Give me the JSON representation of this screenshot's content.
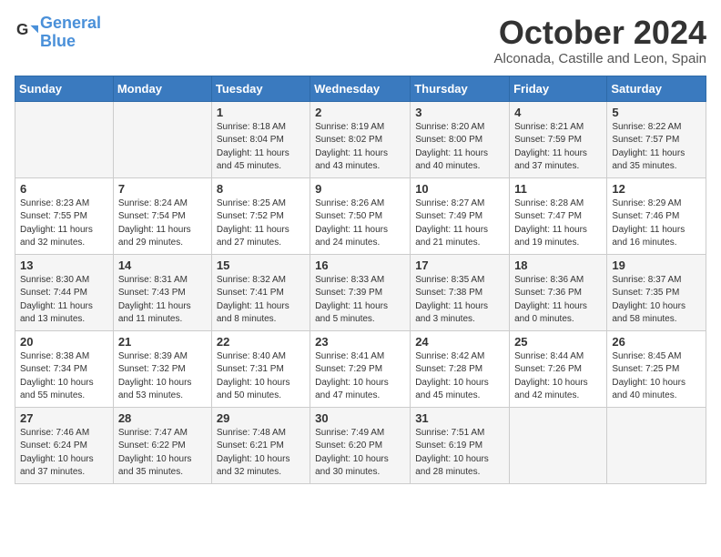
{
  "logo": {
    "line1": "General",
    "line2": "Blue"
  },
  "title": "October 2024",
  "location": "Alconada, Castille and Leon, Spain",
  "days_of_week": [
    "Sunday",
    "Monday",
    "Tuesday",
    "Wednesday",
    "Thursday",
    "Friday",
    "Saturday"
  ],
  "weeks": [
    [
      {
        "day": "",
        "info": ""
      },
      {
        "day": "",
        "info": ""
      },
      {
        "day": "1",
        "info": "Sunrise: 8:18 AM\nSunset: 8:04 PM\nDaylight: 11 hours and 45 minutes."
      },
      {
        "day": "2",
        "info": "Sunrise: 8:19 AM\nSunset: 8:02 PM\nDaylight: 11 hours and 43 minutes."
      },
      {
        "day": "3",
        "info": "Sunrise: 8:20 AM\nSunset: 8:00 PM\nDaylight: 11 hours and 40 minutes."
      },
      {
        "day": "4",
        "info": "Sunrise: 8:21 AM\nSunset: 7:59 PM\nDaylight: 11 hours and 37 minutes."
      },
      {
        "day": "5",
        "info": "Sunrise: 8:22 AM\nSunset: 7:57 PM\nDaylight: 11 hours and 35 minutes."
      }
    ],
    [
      {
        "day": "6",
        "info": "Sunrise: 8:23 AM\nSunset: 7:55 PM\nDaylight: 11 hours and 32 minutes."
      },
      {
        "day": "7",
        "info": "Sunrise: 8:24 AM\nSunset: 7:54 PM\nDaylight: 11 hours and 29 minutes."
      },
      {
        "day": "8",
        "info": "Sunrise: 8:25 AM\nSunset: 7:52 PM\nDaylight: 11 hours and 27 minutes."
      },
      {
        "day": "9",
        "info": "Sunrise: 8:26 AM\nSunset: 7:50 PM\nDaylight: 11 hours and 24 minutes."
      },
      {
        "day": "10",
        "info": "Sunrise: 8:27 AM\nSunset: 7:49 PM\nDaylight: 11 hours and 21 minutes."
      },
      {
        "day": "11",
        "info": "Sunrise: 8:28 AM\nSunset: 7:47 PM\nDaylight: 11 hours and 19 minutes."
      },
      {
        "day": "12",
        "info": "Sunrise: 8:29 AM\nSunset: 7:46 PM\nDaylight: 11 hours and 16 minutes."
      }
    ],
    [
      {
        "day": "13",
        "info": "Sunrise: 8:30 AM\nSunset: 7:44 PM\nDaylight: 11 hours and 13 minutes."
      },
      {
        "day": "14",
        "info": "Sunrise: 8:31 AM\nSunset: 7:43 PM\nDaylight: 11 hours and 11 minutes."
      },
      {
        "day": "15",
        "info": "Sunrise: 8:32 AM\nSunset: 7:41 PM\nDaylight: 11 hours and 8 minutes."
      },
      {
        "day": "16",
        "info": "Sunrise: 8:33 AM\nSunset: 7:39 PM\nDaylight: 11 hours and 5 minutes."
      },
      {
        "day": "17",
        "info": "Sunrise: 8:35 AM\nSunset: 7:38 PM\nDaylight: 11 hours and 3 minutes."
      },
      {
        "day": "18",
        "info": "Sunrise: 8:36 AM\nSunset: 7:36 PM\nDaylight: 11 hours and 0 minutes."
      },
      {
        "day": "19",
        "info": "Sunrise: 8:37 AM\nSunset: 7:35 PM\nDaylight: 10 hours and 58 minutes."
      }
    ],
    [
      {
        "day": "20",
        "info": "Sunrise: 8:38 AM\nSunset: 7:34 PM\nDaylight: 10 hours and 55 minutes."
      },
      {
        "day": "21",
        "info": "Sunrise: 8:39 AM\nSunset: 7:32 PM\nDaylight: 10 hours and 53 minutes."
      },
      {
        "day": "22",
        "info": "Sunrise: 8:40 AM\nSunset: 7:31 PM\nDaylight: 10 hours and 50 minutes."
      },
      {
        "day": "23",
        "info": "Sunrise: 8:41 AM\nSunset: 7:29 PM\nDaylight: 10 hours and 47 minutes."
      },
      {
        "day": "24",
        "info": "Sunrise: 8:42 AM\nSunset: 7:28 PM\nDaylight: 10 hours and 45 minutes."
      },
      {
        "day": "25",
        "info": "Sunrise: 8:44 AM\nSunset: 7:26 PM\nDaylight: 10 hours and 42 minutes."
      },
      {
        "day": "26",
        "info": "Sunrise: 8:45 AM\nSunset: 7:25 PM\nDaylight: 10 hours and 40 minutes."
      }
    ],
    [
      {
        "day": "27",
        "info": "Sunrise: 7:46 AM\nSunset: 6:24 PM\nDaylight: 10 hours and 37 minutes."
      },
      {
        "day": "28",
        "info": "Sunrise: 7:47 AM\nSunset: 6:22 PM\nDaylight: 10 hours and 35 minutes."
      },
      {
        "day": "29",
        "info": "Sunrise: 7:48 AM\nSunset: 6:21 PM\nDaylight: 10 hours and 32 minutes."
      },
      {
        "day": "30",
        "info": "Sunrise: 7:49 AM\nSunset: 6:20 PM\nDaylight: 10 hours and 30 minutes."
      },
      {
        "day": "31",
        "info": "Sunrise: 7:51 AM\nSunset: 6:19 PM\nDaylight: 10 hours and 28 minutes."
      },
      {
        "day": "",
        "info": ""
      },
      {
        "day": "",
        "info": ""
      }
    ]
  ]
}
